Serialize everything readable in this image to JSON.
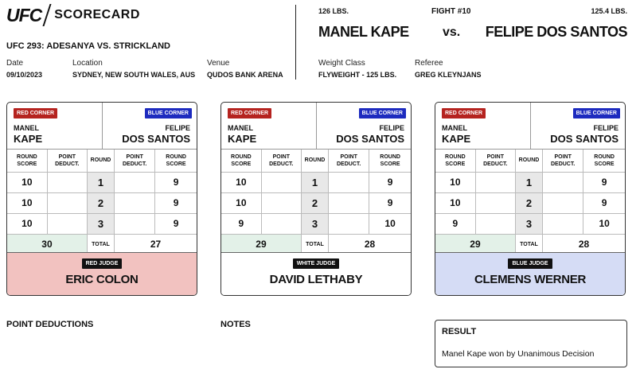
{
  "header": {
    "logo_text": "UFC",
    "logo_subtitle": "SCORECARD",
    "event": "UFC 293: ADESANYA VS. STRICKLAND",
    "date_label": "Date",
    "date": "09/10/2023",
    "location_label": "Location",
    "location": "SYDNEY, NEW SOUTH WALES, AUS",
    "venue_label": "Venue",
    "venue": "QUDOS BANK ARENA",
    "weightclass_label": "Weight Class",
    "weightclass": "FLYWEIGHT - 125 LBS.",
    "referee_label": "Referee",
    "referee": "GREG KLEYNJANS"
  },
  "fight": {
    "number": "FIGHT #10",
    "red_weight": "126 LBS.",
    "blue_weight": "125.4 LBS.",
    "red_name": "MANEL KAPE",
    "vs": "vs.",
    "blue_name": "FELIPE DOS SANTOS"
  },
  "labels": {
    "red_corner": "RED CORNER",
    "blue_corner": "BLUE CORNER",
    "red_first": "MANEL",
    "red_last": "KAPE",
    "blue_first": "FELIPE",
    "blue_last": "DOS SANTOS",
    "round_score": "ROUND SCORE",
    "point_deduct": "POINT DEDUCT.",
    "round": "ROUND",
    "total": "TOTAL"
  },
  "cards": [
    {
      "judge_tag": "RED JUDGE",
      "judge_name": "ERIC COLON",
      "rounds": [
        {
          "red": "10",
          "red_ded": "",
          "round": "1",
          "blue_ded": "",
          "blue": "9"
        },
        {
          "red": "10",
          "red_ded": "",
          "round": "2",
          "blue_ded": "",
          "blue": "9"
        },
        {
          "red": "10",
          "red_ded": "",
          "round": "3",
          "blue_ded": "",
          "blue": "9"
        }
      ],
      "red_total": "30",
      "blue_total": "27"
    },
    {
      "judge_tag": "WHITE JUDGE",
      "judge_name": "DAVID LETHABY",
      "rounds": [
        {
          "red": "10",
          "red_ded": "",
          "round": "1",
          "blue_ded": "",
          "blue": "9"
        },
        {
          "red": "10",
          "red_ded": "",
          "round": "2",
          "blue_ded": "",
          "blue": "9"
        },
        {
          "red": "9",
          "red_ded": "",
          "round": "3",
          "blue_ded": "",
          "blue": "10"
        }
      ],
      "red_total": "29",
      "blue_total": "28"
    },
    {
      "judge_tag": "BLUE JUDGE",
      "judge_name": "CLEMENS WERNER",
      "rounds": [
        {
          "red": "10",
          "red_ded": "",
          "round": "1",
          "blue_ded": "",
          "blue": "9"
        },
        {
          "red": "10",
          "red_ded": "",
          "round": "2",
          "blue_ded": "",
          "blue": "9"
        },
        {
          "red": "9",
          "red_ded": "",
          "round": "3",
          "blue_ded": "",
          "blue": "10"
        }
      ],
      "red_total": "29",
      "blue_total": "28"
    }
  ],
  "footer": {
    "point_deductions": "POINT DEDUCTIONS",
    "notes": "NOTES",
    "result_title": "RESULT",
    "result_text": "Manel Kape won by Unanimous Decision"
  },
  "colors": {
    "red_corner": "#b5231f",
    "blue_corner": "#1d2bbf",
    "red_judge_bg": "#f2c2c0",
    "blue_judge_bg": "#d5dcf5",
    "winner_total_bg": "#e3f1e8"
  }
}
